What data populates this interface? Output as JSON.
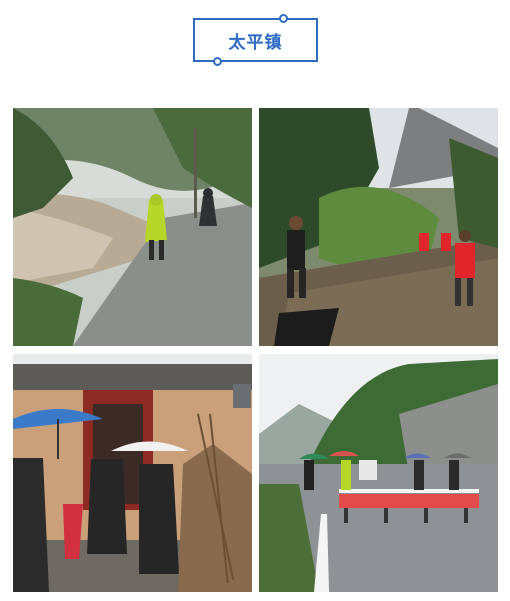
{
  "header": {
    "title": "太平镇"
  },
  "photos": [
    {
      "id": "flood-road",
      "icon": "flood-scene-photo"
    },
    {
      "id": "fallen-tree",
      "icon": "fallen-tree-photo"
    },
    {
      "id": "village-house",
      "icon": "house-raincoats-photo"
    },
    {
      "id": "road-barrier",
      "icon": "road-checkpoint-photo"
    }
  ],
  "colors": {
    "accent": "#2e6bc4",
    "rescue_vest": "#e0262a",
    "raincoat_green": "#b6d62a"
  }
}
